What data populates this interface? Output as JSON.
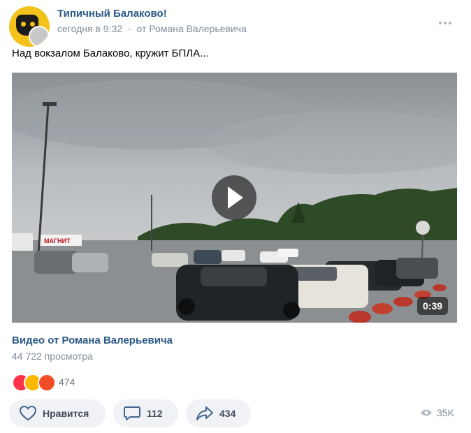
{
  "post": {
    "group_name": "Типичный Балаково!",
    "time": "сегодня в 9:32",
    "separator": "·",
    "author": "от Романа Валерьевича",
    "text": "Над вокзалом Балаково, кружит БПЛА..."
  },
  "video": {
    "duration": "0:39",
    "shop_sign": "МАГНИТ",
    "title": "Видео от Романа Валерьевича",
    "views": "44 722 просмотра"
  },
  "reactions": {
    "icons": [
      "heart-reaction-icon",
      "surprised-reaction-icon",
      "angry-reaction-icon"
    ],
    "count": "474"
  },
  "actions": {
    "like_label": "Нравится",
    "comments_count": "112",
    "shares_count": "434",
    "views_count": "35K"
  },
  "colors": {
    "link": "#2a5885",
    "secondary": "#818c99",
    "button_bg": "#f0f2f5",
    "icon": "#45678f"
  }
}
